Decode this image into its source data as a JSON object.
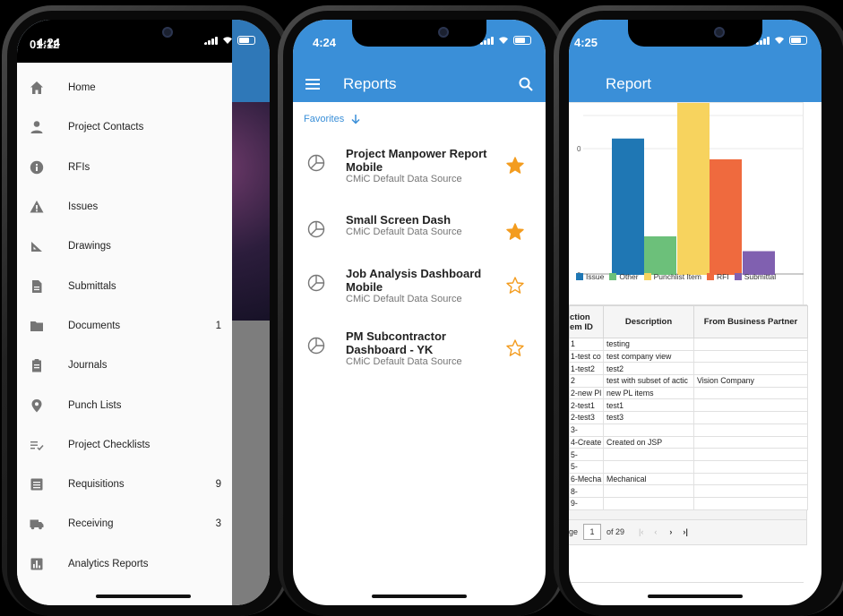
{
  "phone1": {
    "status_time": "4:24",
    "drawer_time": "01:12",
    "menu": [
      {
        "label": "Home",
        "icon": "home-icon",
        "count": ""
      },
      {
        "label": "Project Contacts",
        "icon": "person-icon",
        "count": ""
      },
      {
        "label": "RFIs",
        "icon": "info-icon",
        "count": ""
      },
      {
        "label": "Issues",
        "icon": "warning-icon",
        "count": ""
      },
      {
        "label": "Drawings",
        "icon": "drawing-icon",
        "count": ""
      },
      {
        "label": "Submittals",
        "icon": "file-icon",
        "count": ""
      },
      {
        "label": "Documents",
        "icon": "folder-icon",
        "count": "1"
      },
      {
        "label": "Journals",
        "icon": "clipboard-icon",
        "count": ""
      },
      {
        "label": "Punch Lists",
        "icon": "pin-icon",
        "count": ""
      },
      {
        "label": "Project Checklists",
        "icon": "checklist-icon",
        "count": ""
      },
      {
        "label": "Requisitions",
        "icon": "list-icon",
        "count": "9"
      },
      {
        "label": "Receiving",
        "icon": "truck-icon",
        "count": "3"
      },
      {
        "label": "Analytics Reports",
        "icon": "chart-icon",
        "count": ""
      }
    ]
  },
  "phone2": {
    "status_time": "4:24",
    "title": "Reports",
    "favorites_label": "Favorites",
    "reports": [
      {
        "name": "Project Manpower Report Mobile",
        "source": "CMiC Default Data Source",
        "favorite": true
      },
      {
        "name": "Small Screen Dash",
        "source": "CMiC Default Data Source",
        "favorite": true
      },
      {
        "name": "Job Analysis Dashboard Mobile",
        "source": "CMiC Default Data Source",
        "favorite": false
      },
      {
        "name": "PM Subcontractor Dashboard - YK",
        "source": "CMiC Default Data Source",
        "favorite": false
      }
    ]
  },
  "phone3": {
    "status_time": "4:25",
    "title": "Report",
    "chart_data": {
      "type": "bar",
      "categories": [
        "Issue",
        "Other",
        "Punchlist Item",
        "RFI",
        "Submittal"
      ],
      "values": [
        46,
        13,
        58,
        39,
        8
      ],
      "colors": [
        "#1f77b4",
        "#6cc07a",
        "#f7d35e",
        "#ef6a3e",
        "#8060b0"
      ],
      "legend": [
        "Issue",
        "Other",
        "Punchlist Item",
        "RFI",
        "Submittal"
      ],
      "legend_position": "bottom",
      "tick_labels": [
        "0",
        "0"
      ]
    },
    "table": {
      "headers": [
        "ction em ID",
        "Description",
        "From Business Partner"
      ],
      "rows": [
        [
          "1",
          "testing",
          ""
        ],
        [
          "1-test co",
          "test company view",
          ""
        ],
        [
          "1-test2",
          "test2",
          ""
        ],
        [
          "2",
          "test with subset of actic",
          "Vision Company"
        ],
        [
          "2-new Pl",
          "new PL items",
          ""
        ],
        [
          "2-test1",
          "test1",
          ""
        ],
        [
          "2-test3",
          "test3",
          ""
        ],
        [
          "3-",
          "",
          ""
        ],
        [
          "4-Create",
          "Created on JSP",
          ""
        ],
        [
          "5-",
          "",
          ""
        ],
        [
          "5-",
          "",
          ""
        ],
        [
          "6-Mecha",
          "Mechanical",
          ""
        ],
        [
          "8-",
          "",
          ""
        ],
        [
          "9-",
          "",
          ""
        ]
      ]
    },
    "pager": {
      "page_label": "ge",
      "page_value": "1",
      "of_label": "of 29"
    }
  }
}
